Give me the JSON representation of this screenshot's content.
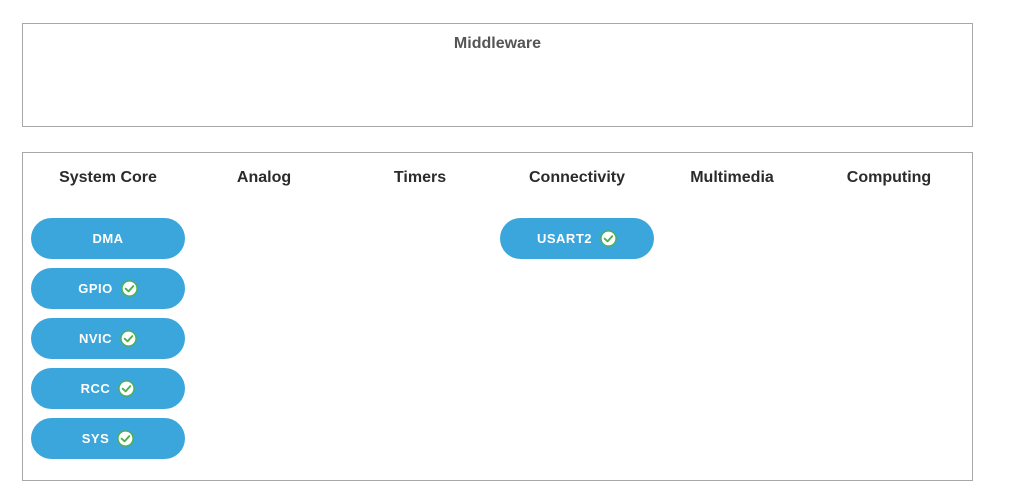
{
  "middleware": {
    "title": "Middleware"
  },
  "categories": [
    {
      "label": "System Core"
    },
    {
      "label": "Analog"
    },
    {
      "label": "Timers"
    },
    {
      "label": "Connectivity"
    },
    {
      "label": "Multimedia"
    },
    {
      "label": "Computing"
    }
  ],
  "system_core": [
    {
      "label": "DMA",
      "configured": false
    },
    {
      "label": "GPIO",
      "configured": true
    },
    {
      "label": "NVIC",
      "configured": true
    },
    {
      "label": "RCC",
      "configured": true
    },
    {
      "label": "SYS",
      "configured": true
    }
  ],
  "connectivity": [
    {
      "label": "USART2",
      "configured": true
    }
  ],
  "colors": {
    "button": "#3aa6dc",
    "check_fill": "#ffffff",
    "check_ring": "#4caf50"
  },
  "icons": {
    "configured": "check-circle-icon"
  }
}
